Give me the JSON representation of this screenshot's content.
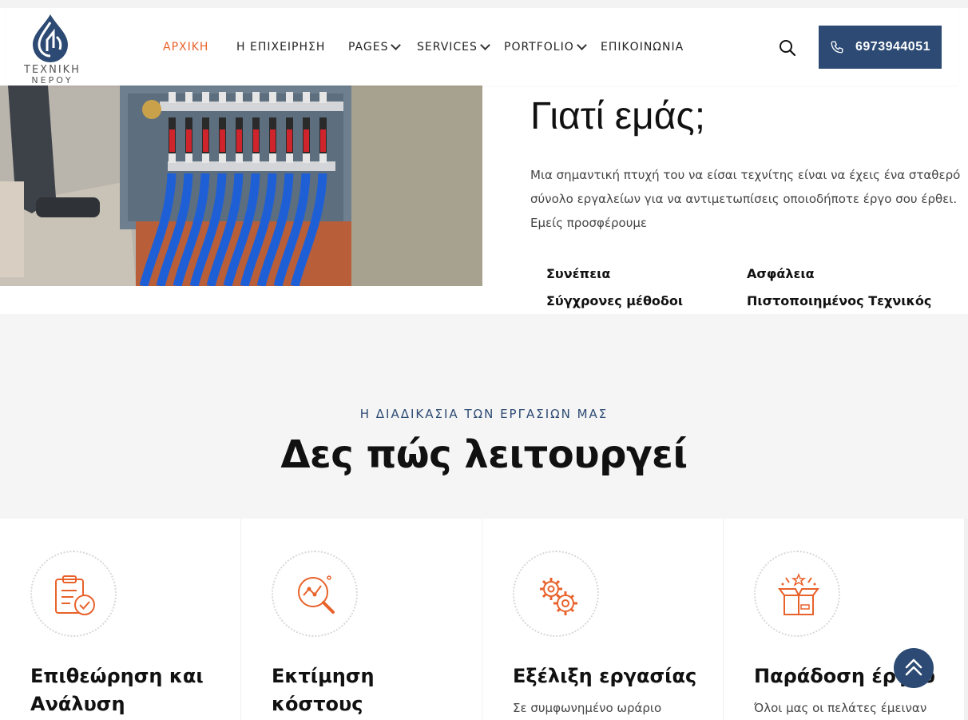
{
  "header": {
    "logo": {
      "line1": "ΤΕΧΝΙΚΗ",
      "line2": "ΝΕΡΟΥ"
    },
    "nav": [
      {
        "label": "ΑΡΧΙΚΗ",
        "active": true
      },
      {
        "label": "Η ΕΠΙΧΕΙΡΗΣΗ"
      },
      {
        "label": "PAGES",
        "dropdown": true
      },
      {
        "label": "SERVICES",
        "dropdown": true
      },
      {
        "label": "PORTFOLIO",
        "dropdown": true
      },
      {
        "label": "ΕΠΙΚΟΙΝΩΝΙΑ"
      }
    ],
    "search_icon": "search-icon",
    "phone": {
      "icon": "phone-icon",
      "number": "6973944051"
    }
  },
  "why": {
    "title": "Γιατί εμάς;",
    "text": "Μια σημαντική πτυχή του να είσαι τεχνίτης είναι να έχεις ένα σταθερό σύνολο εργαλείων για να αντιμετωπίσεις οποιοδήποτε έργο σου έρθει. Εμείς προσφέρουμε",
    "features": [
      "Συνέπεια",
      "Ασφάλεια",
      "Σύγχρονες μέθοδοι",
      "Πιστοποιημένος Τεχνικός"
    ]
  },
  "process": {
    "subtitle": "Η ΔΙΑΔΙΚΑΣΙΑ ΤΩΝ ΕΡΓΑΣΙΩΝ ΜΑΣ",
    "title": "Δες πώς λειτουργεί",
    "cards": [
      {
        "icon": "clipboard-check-icon",
        "title": "Επιθεώρηση και Ανάλυση",
        "text": ""
      },
      {
        "icon": "magnifier-chart-icon",
        "title": "Εκτίμηση κόστους",
        "text": ""
      },
      {
        "icon": "gears-icon",
        "title": "Εξέλιξη εργασίας",
        "text": "Σε συμφωνημένο ωράριο"
      },
      {
        "icon": "box-stars-icon",
        "title": "Παράδοση έργου",
        "text": "Όλοι μας οι πελάτες έμειναν"
      }
    ]
  },
  "colors": {
    "accent": "#e8622b",
    "brand": "#2c4a73"
  }
}
